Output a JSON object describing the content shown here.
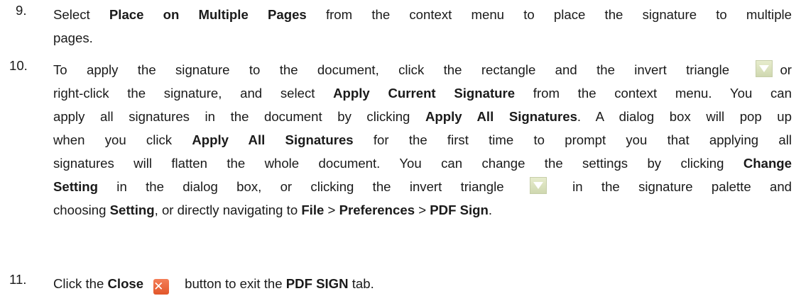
{
  "step9": {
    "number": "9.",
    "lines": [
      [
        "Select ",
        {
          "b": "Place on Multiple Pages"
        },
        " from the context menu to place the signature to multiple"
      ],
      [
        "pages."
      ]
    ]
  },
  "step10": {
    "number": "10.",
    "lines": [
      [
        "To apply the signature to the document, click the rectangle and the invert triangle ",
        {
          "icon": "invert-triangle-icon"
        },
        "or"
      ],
      [
        "right-click the signature, and select ",
        {
          "b": "Apply Current Signature"
        },
        " from the context menu. You can"
      ],
      [
        "apply all signatures in the document by clicking ",
        {
          "b": "Apply All Signatures"
        },
        ". A dialog box will pop up"
      ],
      [
        "when you click ",
        {
          "b": "Apply All Signatures"
        },
        " for the first time to prompt you that applying all"
      ],
      [
        "signatures will flatten the whole document. You can change the settings by clicking ",
        {
          "b": "Change"
        }
      ],
      [
        {
          "b": "Setting"
        },
        " in the dialog box, or clicking the invert triangle ",
        {
          "icon": "invert-triangle-icon"
        },
        " in the signature palette and"
      ],
      [
        "choosing ",
        {
          "b": "Setting"
        },
        ", or directly navigating to ",
        {
          "b": "File"
        },
        " > ",
        {
          "b": "Preferences"
        },
        " > ",
        {
          "b": "PDF Sign"
        },
        "."
      ]
    ]
  },
  "step11": {
    "number": "11.",
    "lines": [
      [
        "Click the ",
        {
          "b": "Close"
        },
        {
          "icon": "close-icon"
        },
        "button to exit the ",
        {
          "b": "PDF SIGN"
        },
        " tab."
      ]
    ]
  },
  "icons": {
    "invert_triangle_color": "#d6ddb8",
    "close_color": "#e8603a"
  }
}
